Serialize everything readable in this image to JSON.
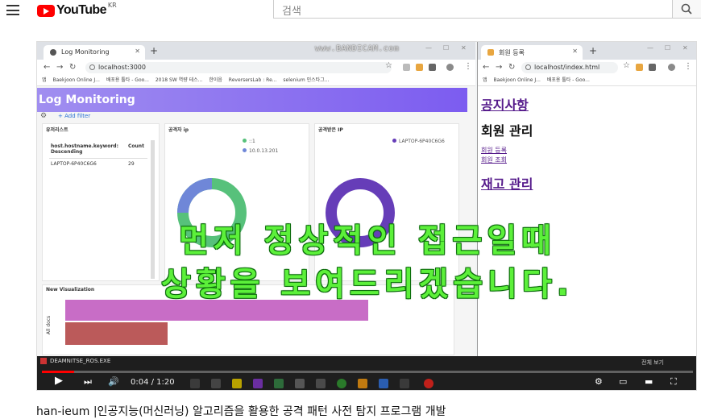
{
  "youtube": {
    "logo_text": "YouTube",
    "region": "KR",
    "search_placeholder": "검색"
  },
  "left_browser": {
    "tab_title": "Log Monitoring",
    "watermark": "www.BANDICAM.com",
    "url": "localhost:3000",
    "bookmarks": [
      "앱",
      "Baekjoon Online J...",
      "배포용 툴타 - Goo...",
      "2018 SW 역량 테스...",
      "한이음",
      "ReversersLab : Re...",
      "selenium 인스타그..."
    ],
    "header": "Log Monitoring",
    "add_filter": "+ Add filter",
    "panels": {
      "list": {
        "title": "유저리스트",
        "col1": "host.hostname.keyword: Descending",
        "col2": "Count",
        "row_host": "LAPTOP-6P40C6G6",
        "row_count": "29"
      },
      "ip": {
        "title": "공격자 ip",
        "legend": [
          "::1",
          "10.0.13.201"
        ],
        "colors": [
          "#57c17b",
          "#6f87d8"
        ]
      },
      "attacked": {
        "title": "공격받은 IP",
        "legend": [
          "LAPTOP-6P40C6G6"
        ],
        "colors": [
          "#663db8"
        ]
      },
      "viz": {
        "title": "New Visualization",
        "ylabel": "All docs",
        "bar_colors": [
          "#c86dc6",
          "#bb5a5a"
        ],
        "bar_fractions": [
          0.8,
          0.27
        ]
      }
    }
  },
  "right_browser": {
    "tab_title": "회원 등록",
    "url": "localhost/index.html",
    "bookmarks": [
      "앱",
      "Baekjoon Online J...",
      "배포용 툴타 - Goo..."
    ],
    "notice_link": "공지사항",
    "member_heading": "회원 관리",
    "member_register": "회원 등록",
    "member_search": "회원 조회",
    "stock_link": "재고 관리"
  },
  "subtitle": {
    "line1": "먼저 정상적인 접근일때",
    "line2": "상황을 보여드리겠습니다."
  },
  "taskbar": {
    "file_label": "DEAMNITSE_ROS.EXE",
    "show_all": "전체 보기"
  },
  "player": {
    "time": "0:04 / 1:20",
    "progress": 0.05
  },
  "video_title": "han-ieum |인공지능(머신러닝) 알고리즘을 활용한 공격 패턴 사전 탐지 프로그램 개발"
}
